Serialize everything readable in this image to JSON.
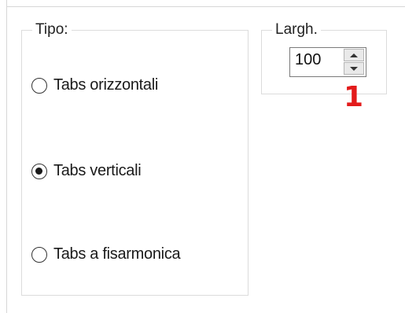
{
  "tipo_group": {
    "legend": "Tipo:",
    "options": [
      {
        "label": "Tabs orizzontali",
        "checked": false
      },
      {
        "label": "Tabs verticali",
        "checked": true
      },
      {
        "label": "Tabs a fisarmonica",
        "checked": false
      }
    ]
  },
  "largh_group": {
    "legend": "Largh.",
    "spin_value": "100"
  },
  "annotation": {
    "text": "1",
    "color": "#e31b1b"
  }
}
